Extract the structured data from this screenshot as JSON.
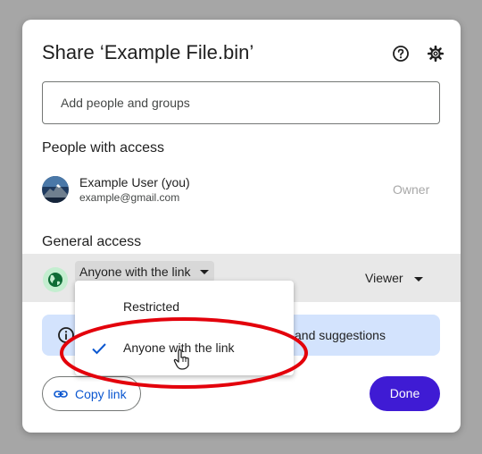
{
  "dialog": {
    "title": "Share ‘Example File.bin’",
    "help_icon": "help-circle-icon",
    "settings_icon": "gear-icon"
  },
  "add_people": {
    "placeholder": "Add people and groups",
    "value": ""
  },
  "people_section": {
    "heading": "People with access",
    "users": [
      {
        "name": "Example User (you)",
        "email": "example@gmail.com",
        "role": "Owner",
        "avatar_icon": "mountain-avatar-icon"
      }
    ]
  },
  "general_access": {
    "heading": "General access",
    "icon": "globe-icon",
    "selected": "Anyone with the link",
    "role": "Viewer"
  },
  "info_bar": {
    "icon": "info-icon",
    "text_visible": "and suggestions"
  },
  "footer": {
    "copy_link_label": "Copy link",
    "copy_link_icon": "link-icon",
    "done_label": "Done"
  },
  "dropdown": {
    "options": [
      {
        "label": "Restricted",
        "selected": false
      },
      {
        "label": "Anyone with the link",
        "selected": true
      }
    ]
  },
  "colors": {
    "primary_button": "#3f1bd4",
    "link_blue": "#0b57d0",
    "info_bg": "#d3e3fd",
    "globe_bg": "#c4eed0",
    "highlight_red": "#e3000b"
  }
}
